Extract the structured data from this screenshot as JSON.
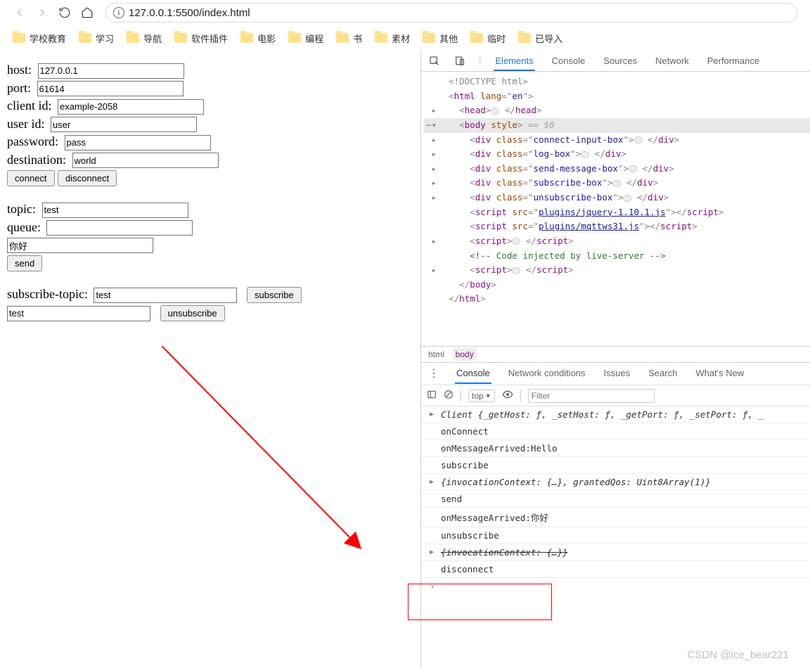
{
  "toolbar": {
    "url": "127.0.0.1:5500/index.html"
  },
  "bookmarks": [
    "学校教育",
    "学习",
    "导航",
    "软件插件",
    "电影",
    "编程",
    "书",
    "素材",
    "其他",
    "临时",
    "已导入"
  ],
  "form": {
    "host_label": "host:",
    "host": "127.0.0.1",
    "port_label": "port:",
    "port": "61614",
    "client_label": "client id:",
    "client": "example-2058",
    "user_label": "user id:",
    "user": "user",
    "pass_label": "password:",
    "pass": "pass",
    "dest_label": "destination:",
    "dest": "world",
    "connect": "connect",
    "disconnect": "disconnect",
    "topic_label": "topic:",
    "topic": "test",
    "queue_label": "queue:",
    "queue": "",
    "msg": "你好",
    "send": "send",
    "subtopic_label": "subscribe-topic:",
    "subtopic": "test",
    "subscribe": "subscribe",
    "unsubtopic": "test",
    "unsubscribe": "unsubscribe"
  },
  "devtools": {
    "tabs": [
      "Elements",
      "Console",
      "Sources",
      "Network",
      "Performance"
    ],
    "active_tab": "Elements",
    "doc": {
      "doctype": "<!DOCTYPE html>",
      "html_open": "<html lang=\"en\">",
      "head": "<head>",
      "head_close": "</head>",
      "body_open": "<body style>",
      "eq0": " == $0",
      "divs": [
        "connect-input-box",
        "log-box",
        "send-message-box",
        "subscribe-box",
        "unsubscribe-box"
      ],
      "script_src": [
        "plugins/jquery-1.10.1.js",
        "plugins/mqttws31.js"
      ],
      "comment": "<!-- Code injected by live-server -->",
      "body_close": "</body>",
      "html_close": "</html>"
    },
    "crumb": [
      "html",
      "body"
    ],
    "crumb_active": "body",
    "sub_tabs": [
      "Console",
      "Network conditions",
      "Issues",
      "Search",
      "What's New"
    ],
    "sub_active": "Console",
    "top_dd": "top",
    "filter_ph": "Filter",
    "console": [
      {
        "caret": "▶",
        "text": "Client {_getHost: ƒ, _setHost: ƒ, _getPort: ƒ, _setPort: ƒ, _",
        "ital": true
      },
      {
        "text": "onConnect"
      },
      {
        "text": "onMessageArrived:Hello"
      },
      {
        "text": "subscribe"
      },
      {
        "caret": "▶",
        "text": "{invocationContext: {…}, grantedQos: Uint8Array(1)}",
        "ital": true
      },
      {
        "text": "send"
      },
      {
        "text": "onMessageArrived:你好"
      },
      {
        "text": "unsubscribe"
      },
      {
        "caret": "▶",
        "text": "{invocationContext: {…}}",
        "ital": true,
        "strike": true
      },
      {
        "text": "disconnect"
      }
    ]
  },
  "watermark": "CSDN @ice_bear221"
}
